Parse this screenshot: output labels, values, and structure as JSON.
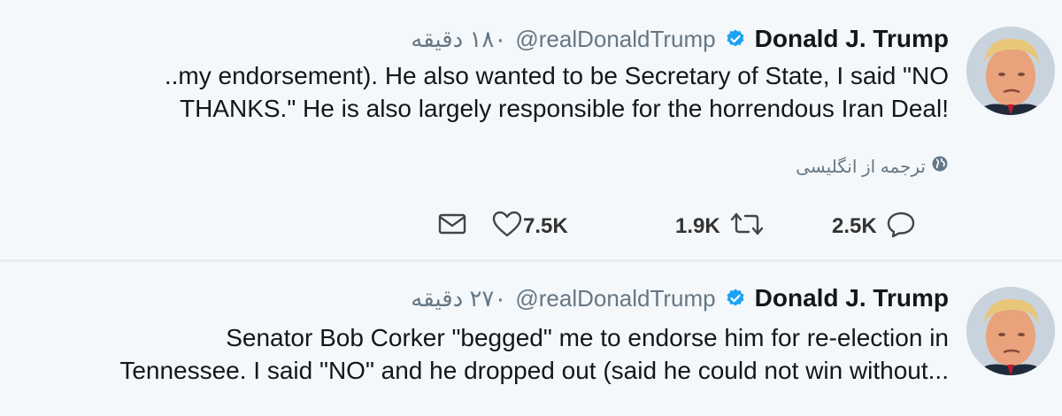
{
  "tweets": [
    {
      "display_name": "Donald J. Trump",
      "handle": "@realDonaldTrump",
      "time": "۱۸٠ دقیقه",
      "text_lines": [
        "..my endorsement). He also wanted to be Secretary of State, I said \"NO",
        "THANKS.\" He is also largely responsible for the horrendous Iran Deal!"
      ],
      "translate_label": "ترجمه از انگلیسی",
      "replies": "2.5K",
      "retweets": "1.9K",
      "likes": "7.5K"
    },
    {
      "display_name": "Donald J. Trump",
      "handle": "@realDonaldTrump",
      "time": "۲۷٠ دقیقه",
      "text_lines": [
        "Senator Bob Corker \"begged\" me to endorse him for re-election in",
        "Tennessee. I said \"NO\" and he dropped out (said he could not win without..."
      ]
    }
  ],
  "icons": {
    "verified": "verified-badge-icon",
    "globe": "globe-icon",
    "reply": "reply-icon",
    "retweet": "retweet-icon",
    "like": "heart-icon",
    "dm": "envelope-icon"
  },
  "colors": {
    "verified": "#1da1f2",
    "muted": "#657786",
    "background": "#f5f8fa"
  }
}
